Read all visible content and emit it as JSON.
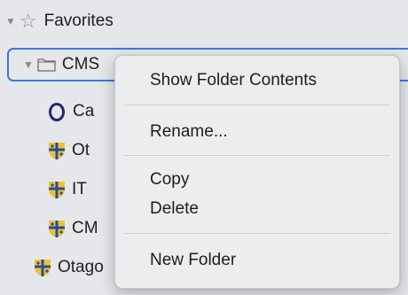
{
  "sidebar": {
    "favorites_label": "Favorites",
    "folder_label": "CMS",
    "items": [
      {
        "label": "Ca",
        "icon": "opera-icon"
      },
      {
        "label": "Ot",
        "icon": "otago-crest-icon"
      },
      {
        "label": "IT ",
        "icon": "otago-crest-icon"
      },
      {
        "label": "CM",
        "icon": "otago-crest-icon"
      }
    ],
    "bottom_item_label": "Otago"
  },
  "context_menu": {
    "show_folder_contents": "Show Folder Contents",
    "rename": "Rename...",
    "copy": "Copy",
    "delete": "Delete",
    "new_folder": "New Folder"
  },
  "colors": {
    "selection_border": "#3b7ad9",
    "opera_red": "#cc1b1b",
    "crest_yellow": "#f2c22e",
    "crest_blue": "#1f4fa3"
  }
}
